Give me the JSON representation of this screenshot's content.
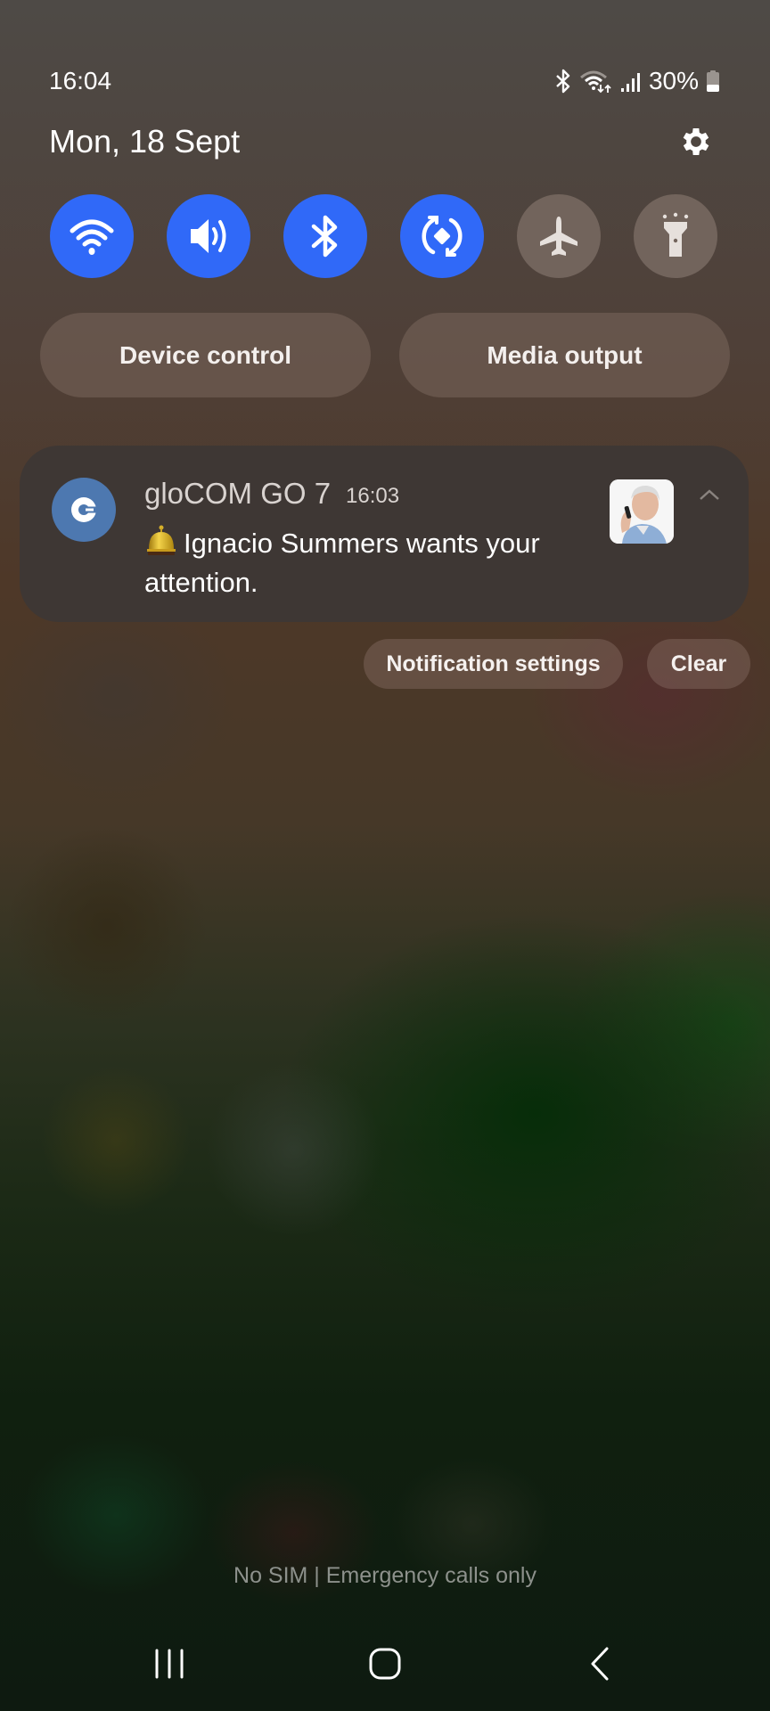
{
  "status_bar": {
    "time": "16:04",
    "icons": [
      "bluetooth-icon",
      "wifi-data-icon",
      "signal-icon",
      "battery-icon"
    ],
    "battery_percent": "30%"
  },
  "header": {
    "date": "Mon, 18 Sept",
    "settings_icon": "gear-icon"
  },
  "quick_toggles": [
    {
      "name": "Wi-Fi",
      "icon": "wifi-icon",
      "state": "on"
    },
    {
      "name": "Sound",
      "icon": "volume-icon",
      "state": "on"
    },
    {
      "name": "Bluetooth",
      "icon": "bluetooth-icon",
      "state": "on"
    },
    {
      "name": "Auto rotate",
      "icon": "rotate-icon",
      "state": "on"
    },
    {
      "name": "Aeroplane mode",
      "icon": "airplane-icon",
      "state": "off"
    },
    {
      "name": "Torch",
      "icon": "flashlight-icon",
      "state": "off"
    }
  ],
  "pills": {
    "device_control": "Device control",
    "media_output": "Media output"
  },
  "notification": {
    "app_name": "gloCOM GO 7",
    "time": "16:03",
    "emoji": "🛎",
    "message": "Ignacio Summers wants your attention.",
    "accent_color": "#4d78b0"
  },
  "notification_actions": {
    "settings": "Notification settings",
    "clear": "Clear"
  },
  "footer": {
    "sim_status": "No SIM | Emergency calls only"
  },
  "nav_bar": {
    "recents": "recents-icon",
    "home": "home-icon",
    "back": "back-icon"
  },
  "colors": {
    "toggle_on": "#3069f8",
    "toggle_off": "#72645c"
  }
}
